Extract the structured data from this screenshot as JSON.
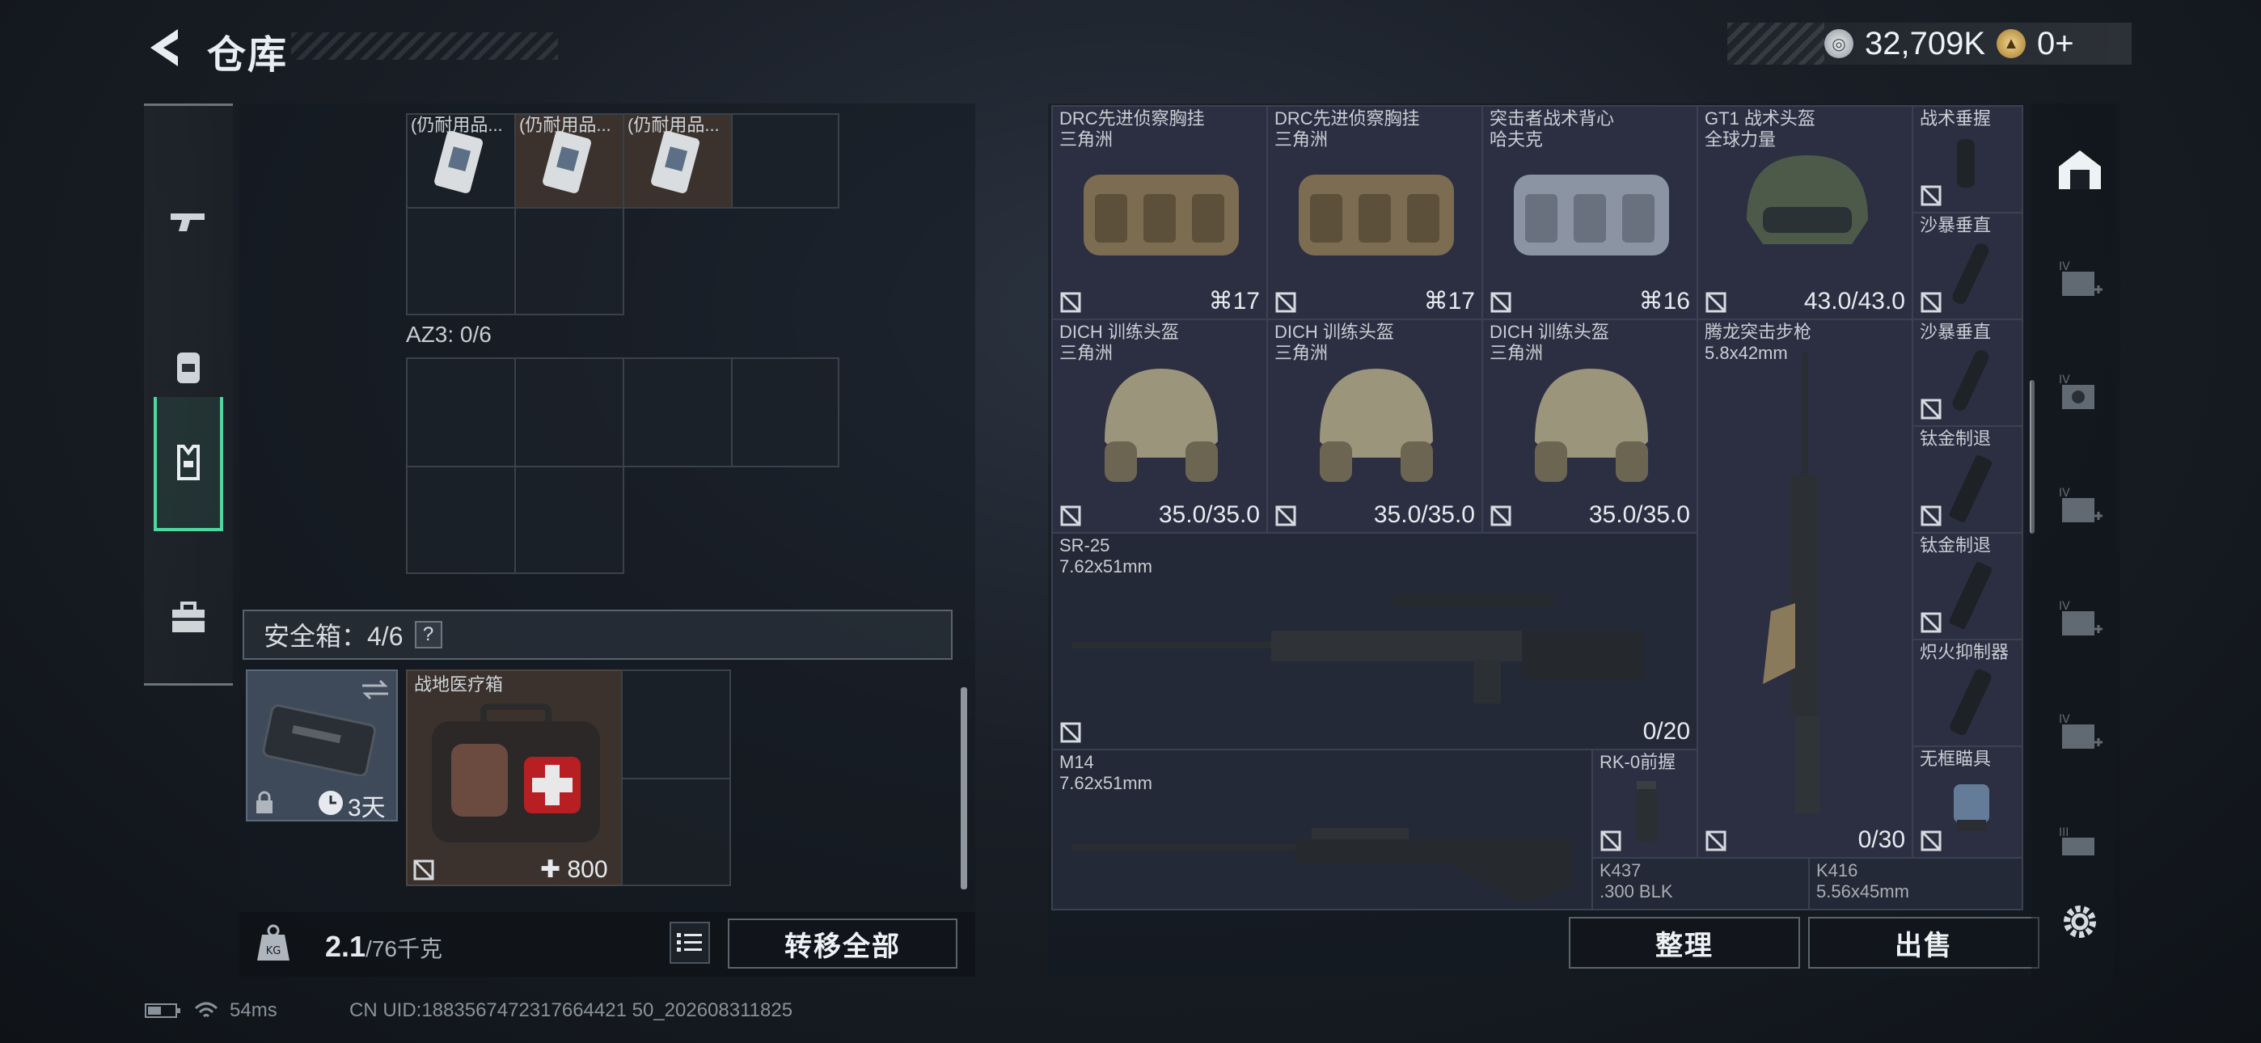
{
  "header": {
    "title": "仓库"
  },
  "currency": {
    "silver_amount": "32,709K",
    "gold_amount": "0+"
  },
  "left_nav": {
    "items": [
      "weapon",
      "backpack",
      "vest",
      "case"
    ],
    "active_index": 2
  },
  "stash": {
    "top_items": [
      "(仍耐用品...",
      "(仍耐用品...",
      "(仍耐用品..."
    ],
    "az3_label": "AZ3: 0/6",
    "safebox_label": "安全箱：4/6",
    "safebox_help": "?",
    "safebox_timer": "3天",
    "medkit_name": "战地医疗箱",
    "medkit_value": "800",
    "weight": "2.1",
    "weight_total": "/76千克",
    "transfer_all": "转移全部"
  },
  "inventory": {
    "items": [
      {
        "name": "DRC先进侦察胸挂",
        "sub": "三角洲",
        "value": "17"
      },
      {
        "name": "DRC先进侦察胸挂",
        "sub": "三角洲",
        "value": "17"
      },
      {
        "name": "突击者战术背心",
        "sub": "哈夫克",
        "value": "16"
      },
      {
        "name": "GT1 战术头盔",
        "sub": "全球力量",
        "value": "43.0/43.0"
      },
      {
        "name": "DICH 训练头盔",
        "sub": "三角洲",
        "value": "35.0/35.0"
      },
      {
        "name": "DICH 训练头盔",
        "sub": "三角洲",
        "value": "35.0/35.0"
      },
      {
        "name": "DICH 训练头盔",
        "sub": "三角洲",
        "value": "35.0/35.0"
      },
      {
        "name": "腾龙突击步枪",
        "sub": "5.8x42mm",
        "value": "0/30"
      },
      {
        "name": "SR-25",
        "sub": "7.62x51mm",
        "value": "0/20"
      },
      {
        "name": "M14",
        "sub": "7.62x51mm",
        "value": ""
      },
      {
        "name": "RK-0前握",
        "sub": "",
        "value": ""
      },
      {
        "name": "K437",
        "sub": ".300 BLK",
        "value": ""
      },
      {
        "name": "K416",
        "sub": "5.56x45mm",
        "value": ""
      }
    ],
    "attachments": [
      "战术垂握",
      "沙暴垂直",
      "沙暴垂直",
      "钛金制退",
      "钛金制退",
      "炽火抑制器",
      "无框瞄具"
    ],
    "sort_button": "整理",
    "sell_button": "出售"
  },
  "status": {
    "ping": "54ms",
    "uid": "CN UID:1883567472317664421 50_202608311825"
  },
  "right_nav": {
    "labels": [
      "IV",
      "IV",
      "IV",
      "IV",
      "IV",
      "III"
    ]
  }
}
